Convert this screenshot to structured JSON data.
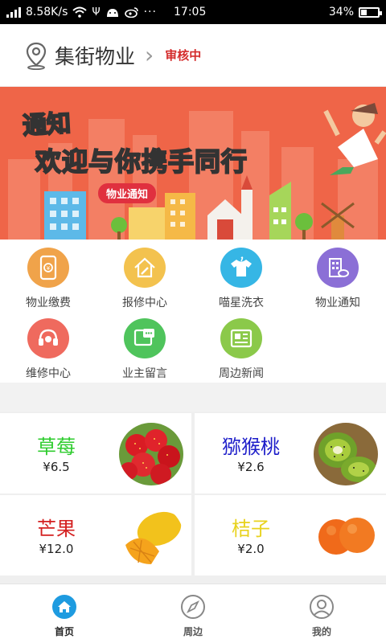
{
  "status_bar": {
    "speed": "8.58K/s",
    "time": "17:05",
    "battery": "34%",
    "battery_level": 0.34
  },
  "header": {
    "community_name": "集街物业",
    "review_status": "审核中"
  },
  "banner": {
    "notice": "通知",
    "headline": "欢迎与你携手同行",
    "pill": "物业通知"
  },
  "menu": [
    {
      "label": "物业缴费",
      "icon": "phone-payment-icon",
      "color": "#f0a34a"
    },
    {
      "label": "报修中心",
      "icon": "house-repair-icon",
      "color": "#f3c24e"
    },
    {
      "label": "喵星洗衣",
      "icon": "laundry-shirt-icon",
      "color": "#36b6e5"
    },
    {
      "label": "物业通知",
      "icon": "building-notice-icon",
      "color": "#8b6fd6"
    },
    {
      "label": "维修中心",
      "icon": "headset-service-icon",
      "color": "#ef6a5e"
    },
    {
      "label": "业主留言",
      "icon": "message-icon",
      "color": "#4fc45c"
    },
    {
      "label": "周边新闻",
      "icon": "newspaper-icon",
      "color": "#8bc94a"
    }
  ],
  "products": [
    {
      "name": "草莓",
      "price": "¥6.5",
      "name_color": "#2ecc2e",
      "image": "strawberry-image"
    },
    {
      "name": "猕猴桃",
      "price": "¥2.6",
      "name_color": "#1c1cc9",
      "image": "kiwi-image"
    },
    {
      "name": "芒果",
      "price": "¥12.0",
      "name_color": "#d42020",
      "image": "mango-image"
    },
    {
      "name": "桔子",
      "price": "¥2.0",
      "name_color": "#e8d21c",
      "image": "orange-image"
    }
  ],
  "tabs": [
    {
      "label": "首页",
      "icon": "home-icon",
      "active": true
    },
    {
      "label": "周边",
      "icon": "compass-icon",
      "active": false
    },
    {
      "label": "我的",
      "icon": "user-icon",
      "active": false
    }
  ],
  "colors": {
    "accent": "#1e9be0",
    "banner": "#ef6548"
  }
}
